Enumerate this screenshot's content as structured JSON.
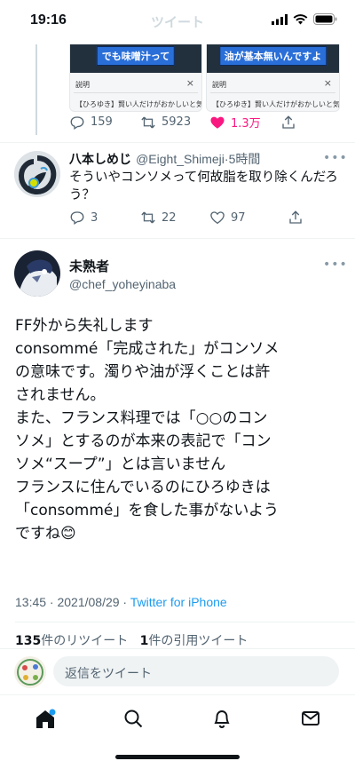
{
  "status_bar": {
    "time": "19:16",
    "faded_title": "ツイート"
  },
  "prev_tweet": {
    "media": [
      {
        "caption": "でも味噌汁って",
        "explain_label": "説明",
        "close": "×",
        "sub": "【ひろゆき】賢い人だけがおかしいと気"
      },
      {
        "caption": "油が基本無いんですよ",
        "explain_label": "説明",
        "close": "×",
        "sub": "【ひろゆき】賢い人だけがおかしいと気"
      }
    ],
    "replies": "159",
    "retweets": "5923",
    "likes": "1.3万",
    "like_color": "#f91880"
  },
  "reply_tweet": {
    "name": "八本しめじ",
    "handle": "@Eight_Shimeji",
    "time": "·5時間",
    "more": "•••",
    "text": "そういやコンソメって何故脂を取り除くんだろう？",
    "replies": "3",
    "retweets": "22",
    "likes": "97"
  },
  "main_tweet": {
    "name": "未熟者",
    "handle": "@chef_yoheyinaba",
    "more": "•••",
    "lines": [
      "FF外から失礼します",
      "consommé「完成された」がコンソメ",
      "の意味です。濁りや油が浮くことは許",
      "されません。",
      "また、フランス料理では「○○のコン",
      "ソメ」とするのが本来の表記で「コン",
      "ソメ“スープ”」とは言いません",
      "フランスに住んでいるのにひろゆきは",
      "「consommé」を食した事がないよう",
      "ですね😊"
    ],
    "timestamp": "13:45 · 2021/08/29 · ",
    "client": "Twitter for iPhone",
    "retweet_count": "135",
    "retweet_label": "件のリツイート",
    "quote_count": "1",
    "quote_label": "件の引用ツイート"
  },
  "reply_box": {
    "placeholder": "返信をツイート"
  },
  "colors": {
    "accent": "#1d9bf0",
    "text": "#0f1419",
    "muted": "#536471"
  },
  "tabs": [
    "home-icon",
    "search-icon",
    "notifications-icon",
    "messages-icon"
  ]
}
